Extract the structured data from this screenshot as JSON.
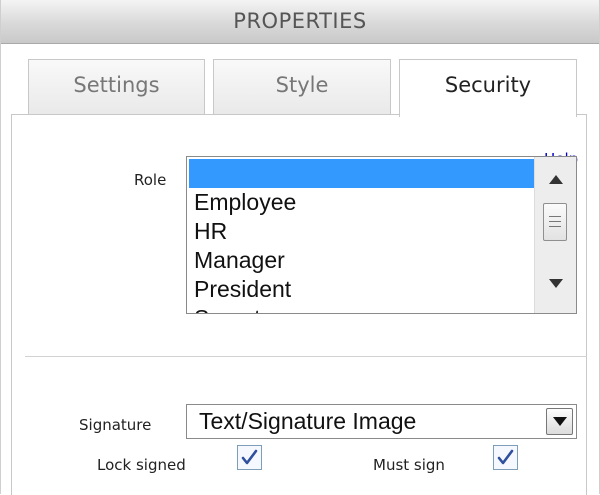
{
  "window": {
    "title": "PROPERTIES"
  },
  "tabs": [
    {
      "label": "Settings",
      "active": false
    },
    {
      "label": "Style",
      "active": false
    },
    {
      "label": "Security",
      "active": true
    }
  ],
  "panel": {
    "help_link": "Help",
    "role": {
      "label": "Role",
      "items": [
        "",
        "Employee",
        "HR",
        "Manager",
        "President",
        "Secretary"
      ],
      "selected_index": 0,
      "selection_color": "#3399ff"
    },
    "signature": {
      "label": "Signature",
      "value": "Text/Signature Image"
    },
    "lock_signed": {
      "label": "Lock signed",
      "checked": true
    },
    "must_sign": {
      "label": "Must sign",
      "checked": true
    }
  },
  "colors": {
    "link": "#0000cc",
    "check": "#2f4f9f"
  }
}
